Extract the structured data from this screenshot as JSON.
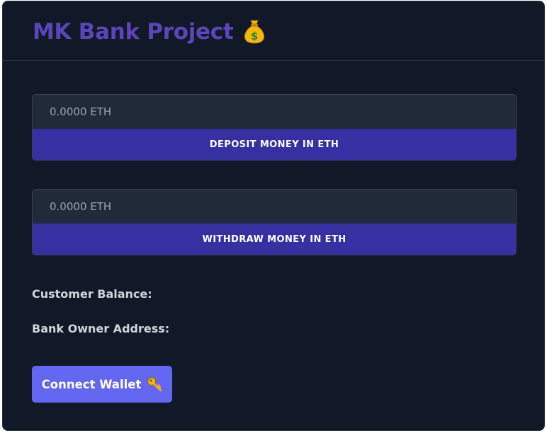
{
  "header": {
    "title": "MK Bank Project",
    "title_icon": "money-bag-icon"
  },
  "deposit": {
    "amount_placeholder": "0.0000 ETH",
    "amount_value": "",
    "button_label": "DEPOSIT MONEY IN ETH"
  },
  "withdraw": {
    "amount_placeholder": "0.0000 ETH",
    "amount_value": "",
    "button_label": "WITHDRAW MONEY IN ETH"
  },
  "info": {
    "balance_label": "Customer Balance:",
    "balance_value": "",
    "owner_label": "Bank Owner Address:",
    "owner_value": ""
  },
  "wallet": {
    "connect_label": "Connect Wallet",
    "connect_icon": "key-icon"
  },
  "colors": {
    "background": "#111827",
    "title": "#5b45b8",
    "input_bg": "#212a38",
    "action_button": "#3730a3",
    "connect_button": "#6366f1",
    "label_text": "#d1d5db"
  }
}
